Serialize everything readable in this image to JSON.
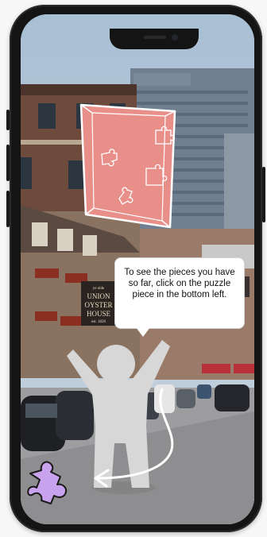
{
  "tutorial": {
    "hint_text": "To see the pieces you have so far, click on the puzzle piece in the bottom left."
  },
  "scene": {
    "sign_lines": [
      "ye olde",
      "UNION",
      "OYSTER",
      "HOUSE",
      "est. 1826"
    ]
  },
  "colors": {
    "map_card": "#e98f8a",
    "puzzle_button": "#c9a2ee",
    "avatar": "#d7d7d7",
    "bubble": "#ffffff"
  },
  "icons": [
    "puzzle-piece-icon",
    "treasure-map-icon",
    "curved-arrow-icon"
  ]
}
